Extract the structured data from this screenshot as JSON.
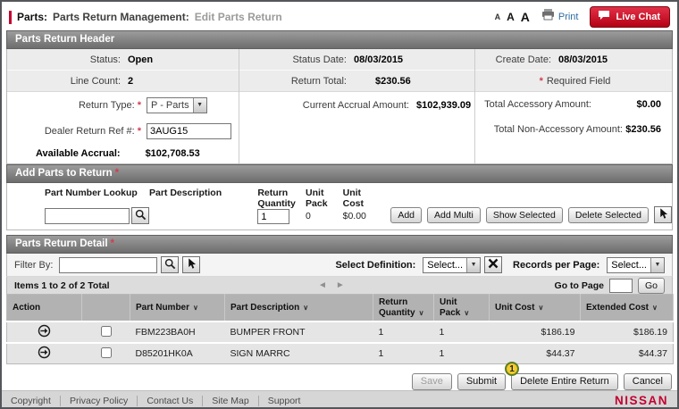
{
  "colors": {
    "nissan_red": "#c3002f",
    "live_chat_red": "#c40016",
    "link_blue": "#2e6da4",
    "section_bar_gray": "#7b7b7b",
    "table_header_gray": "#b2b2b2",
    "row_gray": "#e5e5e5",
    "callout_yellow": "#eebe0e",
    "callout_border_green": "#5a7d2a"
  },
  "icons": {
    "sort": "∨",
    "prev": "◄",
    "next": "►",
    "dropdown": "▼"
  },
  "misc": {
    "required_marker": "*"
  },
  "breadcrumb": {
    "app": "Parts:",
    "section": "Parts Return Management:",
    "page": "Edit Parts Return"
  },
  "top_tools": {
    "font_small": "A",
    "font_medium": "A",
    "font_large": "A",
    "print_label": "Print",
    "live_chat_label": "Live Chat"
  },
  "header": {
    "title": "Parts Return Header",
    "status_label": "Status:",
    "status_value": "Open",
    "line_count_label": "Line Count:",
    "line_count_value": "2",
    "return_type_label": "Return Type:",
    "return_type_value": "P - Parts",
    "dealer_ref_label": "Dealer Return Ref #:",
    "dealer_ref_value": "3AUG15",
    "available_accrual_label": "Available Accrual:",
    "available_accrual_value": "$102,708.53",
    "status_date_label": "Status Date:",
    "status_date_value": "08/03/2015",
    "return_total_label": "Return Total:",
    "return_total_value": "$230.56",
    "current_accrual_label": "Current Accrual Amount:",
    "current_accrual_value": "$102,939.09",
    "create_date_label": "Create Date:",
    "create_date_value": "08/03/2015",
    "required_field_note": "Required Field",
    "total_accessory_label": "Total Accessory Amount:",
    "total_accessory_value": "$0.00",
    "total_non_accessory_label": "Total Non-Accessory Amount:",
    "total_non_accessory_value": "$230.56"
  },
  "add_parts": {
    "title": "Add Parts to Return",
    "col_part_number_lookup": "Part Number Lookup",
    "col_part_description": "Part Description",
    "col_return_quantity": "Return Quantity",
    "col_unit_pack": "Unit Pack",
    "col_unit_cost": "Unit Cost",
    "lookup_value": "",
    "quantity_value": "1",
    "unit_pack_value": "0",
    "unit_cost_value": "$0.00",
    "buttons": {
      "add": "Add",
      "add_multi": "Add Multi",
      "show_selected": "Show Selected",
      "delete_selected": "Delete Selected"
    }
  },
  "detail": {
    "title": "Parts Return Detail",
    "filter_label": "Filter By:",
    "filter_value": "",
    "select_definition_label": "Select Definition:",
    "select_definition_value": "Select...",
    "records_per_page_label": "Records per Page:",
    "records_per_page_value": "Select...",
    "items_summary": "Items 1 to 2 of 2 Total",
    "go_to_page_label": "Go to Page",
    "go_to_page_value": "",
    "go_button": "Go",
    "columns": {
      "action": "Action",
      "part_number": "Part Number",
      "part_description": "Part Description",
      "return_quantity": "Return Quantity",
      "unit_pack": "Unit Pack",
      "unit_cost": "Unit Cost",
      "extended_cost": "Extended Cost"
    },
    "rows": [
      {
        "part_number": "FBM223BA0H",
        "part_description": "BUMPER FRONT",
        "return_quantity": "1",
        "unit_pack": "1",
        "unit_cost": "$186.19",
        "extended_cost": "$186.19"
      },
      {
        "part_number": "D85201HK0A",
        "part_description": "SIGN MARRC",
        "return_quantity": "1",
        "unit_pack": "1",
        "unit_cost": "$44.37",
        "extended_cost": "$44.37"
      }
    ]
  },
  "actions": {
    "save": "Save",
    "submit": "Submit",
    "delete_entire_return": "Delete Entire Return",
    "cancel": "Cancel",
    "callout_number": "1"
  },
  "footer": {
    "links": [
      "Copyright",
      "Privacy Policy",
      "Contact Us",
      "Site Map",
      "Support"
    ],
    "brand": "NISSAN"
  }
}
